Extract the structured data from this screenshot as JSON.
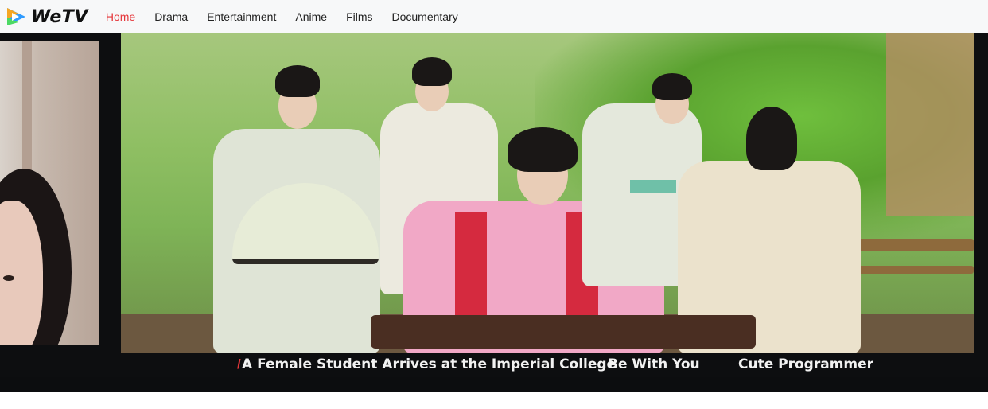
{
  "brand": {
    "name": "WeTV",
    "accent": "#e5363a",
    "logo_colors": [
      "#f5a623",
      "#4cd964",
      "#2f9bff"
    ]
  },
  "nav": {
    "items": [
      {
        "label": "Home",
        "active": true
      },
      {
        "label": "Drama",
        "active": false
      },
      {
        "label": "Entertainment",
        "active": false
      },
      {
        "label": "Anime",
        "active": false
      },
      {
        "label": "Films",
        "active": false
      },
      {
        "label": "Documentary",
        "active": false
      }
    ]
  },
  "carousel": {
    "marker": "/",
    "titles": [
      "A Female Student Arrives at the Imperial College",
      "Be With You",
      "Cute Programmer"
    ],
    "active_index": 0
  }
}
